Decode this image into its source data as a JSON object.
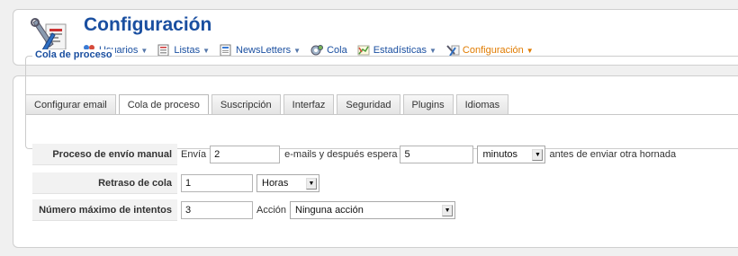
{
  "header": {
    "title": "Configuración",
    "menu": [
      {
        "label": "Usuarios",
        "icon": "users-icon"
      },
      {
        "label": "Listas",
        "icon": "list-icon"
      },
      {
        "label": "NewsLetters",
        "icon": "newsletter-icon"
      },
      {
        "label": "Cola",
        "icon": "queue-icon"
      },
      {
        "label": "Estadísticas",
        "icon": "statistics-icon"
      },
      {
        "label": "Configuración",
        "icon": "configuration-icon",
        "active": true
      }
    ]
  },
  "tabs": [
    {
      "label": "Configurar email"
    },
    {
      "label": "Cola de proceso",
      "active": true
    },
    {
      "label": "Suscripción"
    },
    {
      "label": "Interfaz"
    },
    {
      "label": "Seguridad"
    },
    {
      "label": "Plugins"
    },
    {
      "label": "Idiomas"
    }
  ],
  "section": {
    "legend": "Cola de proceso",
    "manual": {
      "label": "Proceso de envío manual",
      "prefix": "Envía",
      "emails_value": "2",
      "middle": "e-mails y después espera",
      "wait_value": "5",
      "unit_selected": "minutos",
      "suffix": "antes de enviar otra hornada"
    },
    "delay": {
      "label": "Retraso de cola",
      "value": "1",
      "unit_selected": "Horas"
    },
    "attempts": {
      "label": "Número máximo de intentos",
      "value": "3",
      "action_label": "Acción",
      "action_selected": "Ninguna acción"
    }
  },
  "colors": {
    "title_blue": "#1a4fa0",
    "active_orange": "#e07b00"
  }
}
